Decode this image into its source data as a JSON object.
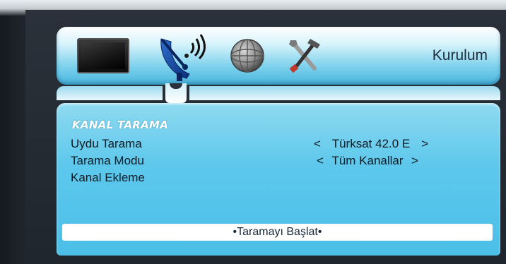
{
  "menu": {
    "title": "Kurulum",
    "icons": [
      "tv-icon",
      "satellite-dish-icon",
      "globe-icon",
      "tools-icon"
    ],
    "selected_icon": "satellite-dish-icon"
  },
  "panel": {
    "title": "KANAL TARAMA",
    "rows": [
      {
        "label": "Uydu Tarama",
        "value": "Türksat 42.0 E",
        "left_arrow": "<",
        "right_arrow": ">"
      },
      {
        "label": "Tarama Modu",
        "value": "Tüm Kanallar",
        "left_arrow": "<",
        "right_arrow": ">"
      },
      {
        "label": "Kanal Ekleme"
      }
    ],
    "start_button": "•Taramayı Başlat•"
  },
  "colors": {
    "panel": "#4bbfe8",
    "menu_bar": "#7ad0ec",
    "title_text": "#ffffff",
    "body_text": "#0f1b24"
  }
}
